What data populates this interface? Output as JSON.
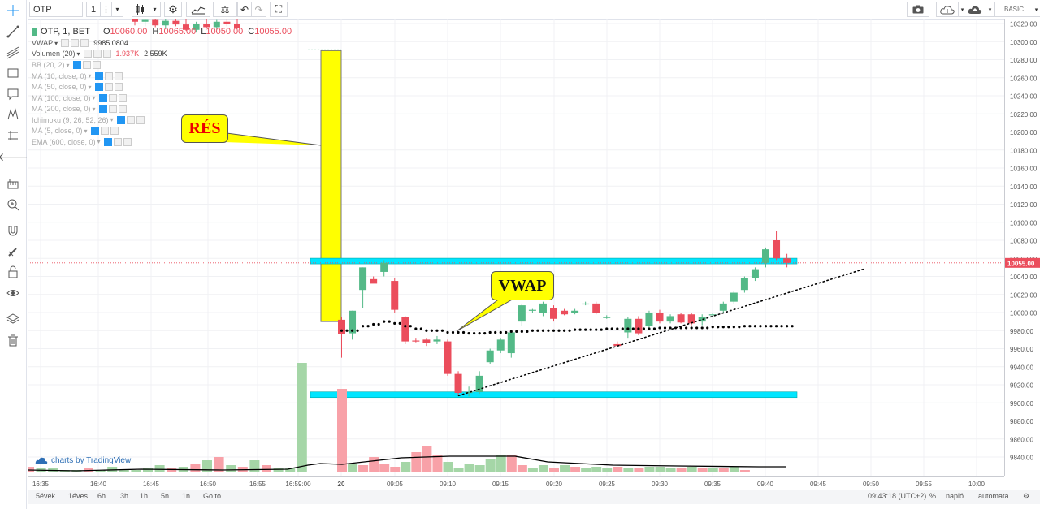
{
  "toolbar": {
    "symbol": "OTP",
    "interval": "1",
    "mode": "BASIC"
  },
  "legend": {
    "title": "OTP, 1, BET",
    "o_label": "O",
    "o_val": "10060.00",
    "h_label": "H",
    "h_val": "10065.00",
    "l_label": "L",
    "l_val": "10050.00",
    "c_label": "C",
    "c_val": "10055.00",
    "vwap_label": "VWAP",
    "vwap_val": "9985.0804",
    "vol_label": "Volumen (20)",
    "vol_val1": "1.937K",
    "vol_val2": "2.559K",
    "indicators": [
      "BB (20, 2)",
      "MA (10, close, 0)",
      "MA (50, close, 0)",
      "MA (100, close, 0)",
      "MA (200, close, 0)",
      "Ichimoku (9, 26, 52, 26)",
      "MA (5, close, 0)",
      "EMA (600, close, 0)"
    ]
  },
  "annotations": {
    "res": "RÉS",
    "vwap": "VWAP"
  },
  "watermark": "charts by TradingView",
  "bottombar": {
    "ranges": [
      "5évek",
      "1éves",
      "6h",
      "3h",
      "1h",
      "5n",
      "1n",
      "Go to..."
    ],
    "clock": "09:43:18 (UTC+2)",
    "pct": "%",
    "log": "napló",
    "auto": "automata"
  },
  "colors": {
    "up": "#53b987",
    "down": "#eb4d5c",
    "zone": "#00e5ff",
    "gap": "#ffff00",
    "accent": "#2196f3"
  },
  "chart_data": {
    "type": "candlestick",
    "title": "OTP, 1, BET",
    "last_price": "10055.00",
    "ylim": [
      9825,
      10325
    ],
    "y_ticks": [
      9840,
      9860,
      9880,
      9900,
      9920,
      9940,
      9960,
      9980,
      10000,
      10020,
      10040,
      10060,
      10080,
      10100,
      10120,
      10140,
      10160,
      10180,
      10200,
      10220,
      10240,
      10260,
      10280,
      10300,
      10320
    ],
    "x_ticks": [
      "16:35",
      "16:40",
      "16:45",
      "16:50",
      "16:55",
      "16:59:00",
      "20",
      "09:05",
      "09:10",
      "09:15",
      "09:20",
      "09:25",
      "09:30",
      "09:35",
      "09:40",
      "09:45",
      "09:50",
      "09:55",
      "10:00"
    ],
    "candles_prev_day": [
      {
        "o": 10325,
        "h": 10328,
        "l": 10318,
        "c": 10322
      },
      {
        "o": 10322,
        "h": 10326,
        "l": 10317,
        "c": 10324
      },
      {
        "o": 10324,
        "h": 10328,
        "l": 10316,
        "c": 10318
      },
      {
        "o": 10318,
        "h": 10326,
        "l": 10314,
        "c": 10323
      },
      {
        "o": 10323,
        "h": 10327,
        "l": 10317,
        "c": 10319
      },
      {
        "o": 10319,
        "h": 10325,
        "l": 10312,
        "c": 10313
      },
      {
        "o": 10313,
        "h": 10322,
        "l": 10310,
        "c": 10320
      },
      {
        "o": 10320,
        "h": 10326,
        "l": 10315,
        "c": 10316
      },
      {
        "o": 10316,
        "h": 10324,
        "l": 10313,
        "c": 10322
      },
      {
        "o": 10322,
        "h": 10326,
        "l": 10317,
        "c": 10320
      },
      {
        "o": 10320,
        "h": 10325,
        "l": 10314,
        "c": 10315
      }
    ],
    "candles": [
      {
        "o": 9992,
        "h": 9995,
        "l": 9950,
        "c": 9976
      },
      {
        "o": 9977,
        "h": 10002,
        "l": 9970,
        "c": 10002
      },
      {
        "o": 10025,
        "h": 10050,
        "l": 10005,
        "c": 10050
      },
      {
        "o": 10037,
        "h": 10040,
        "l": 10035,
        "c": 10032
      },
      {
        "o": 10045,
        "h": 10058,
        "l": 10040,
        "c": 10055
      },
      {
        "o": 10035,
        "h": 10038,
        "l": 10000,
        "c": 10003
      },
      {
        "o": 9995,
        "h": 9996,
        "l": 9965,
        "c": 9968
      },
      {
        "o": 9969,
        "h": 9972,
        "l": 9967,
        "c": 9968
      },
      {
        "o": 9970,
        "h": 9972,
        "l": 9963,
        "c": 9966
      },
      {
        "o": 9968,
        "h": 9974,
        "l": 9965,
        "c": 9970
      },
      {
        "o": 9968,
        "h": 9970,
        "l": 9930,
        "c": 9932
      },
      {
        "o": 9932,
        "h": 9935,
        "l": 9908,
        "c": 9911
      },
      {
        "o": 9911,
        "h": 9918,
        "l": 9907,
        "c": 9912
      },
      {
        "o": 9912,
        "h": 9935,
        "l": 9910,
        "c": 9930
      },
      {
        "o": 9945,
        "h": 9960,
        "l": 9943,
        "c": 9958
      },
      {
        "o": 9958,
        "h": 9972,
        "l": 9955,
        "c": 9970
      },
      {
        "o": 9955,
        "h": 9980,
        "l": 9950,
        "c": 9978
      },
      {
        "o": 9990,
        "h": 10010,
        "l": 9985,
        "c": 10008
      },
      {
        "o": 10002,
        "h": 10004,
        "l": 10000,
        "c": 10003
      },
      {
        "o": 10000,
        "h": 10012,
        "l": 9996,
        "c": 10010
      },
      {
        "o": 10005,
        "h": 10008,
        "l": 9990,
        "c": 9993
      },
      {
        "o": 10002,
        "h": 10004,
        "l": 9997,
        "c": 9998
      },
      {
        "o": 10000,
        "h": 10004,
        "l": 9998,
        "c": 10002
      },
      {
        "o": 10010,
        "h": 10012,
        "l": 10008,
        "c": 10010
      },
      {
        "o": 10010,
        "h": 10012,
        "l": 9998,
        "c": 10000
      },
      {
        "o": 9995,
        "h": 9997,
        "l": 9993,
        "c": 9995
      },
      {
        "o": 9965,
        "h": 9968,
        "l": 9962,
        "c": 9963
      },
      {
        "o": 9978,
        "h": 9995,
        "l": 9972,
        "c": 9993
      },
      {
        "o": 9993,
        "h": 9996,
        "l": 9975,
        "c": 9977
      },
      {
        "o": 9985,
        "h": 10002,
        "l": 9982,
        "c": 10000
      },
      {
        "o": 10000,
        "h": 10003,
        "l": 9988,
        "c": 9990
      },
      {
        "o": 9990,
        "h": 9998,
        "l": 9988,
        "c": 9996
      },
      {
        "o": 9998,
        "h": 10000,
        "l": 9988,
        "c": 9989
      },
      {
        "o": 9998,
        "h": 10000,
        "l": 9986,
        "c": 9988
      },
      {
        "o": 9990,
        "h": 9998,
        "l": 9986,
        "c": 9995
      },
      {
        "o": 9997,
        "h": 10000,
        "l": 9995,
        "c": 9998
      },
      {
        "o": 10002,
        "h": 10012,
        "l": 10000,
        "c": 10010
      },
      {
        "o": 10012,
        "h": 10024,
        "l": 10010,
        "c": 10022
      },
      {
        "o": 10025,
        "h": 10040,
        "l": 10022,
        "c": 10038
      },
      {
        "o": 10038,
        "h": 10050,
        "l": 10035,
        "c": 10048
      },
      {
        "o": 10055,
        "h": 10072,
        "l": 10050,
        "c": 10070
      },
      {
        "o": 10080,
        "h": 10090,
        "l": 10058,
        "c": 10060
      },
      {
        "o": 10060,
        "h": 10065,
        "l": 10050,
        "c": 10055
      }
    ],
    "volume": [
      {
        "v": 3,
        "up": false
      },
      {
        "v": 2,
        "up": true
      },
      {
        "v": 2,
        "up": true
      },
      {
        "v": 1,
        "up": true
      },
      {
        "v": 1,
        "up": true
      },
      {
        "v": 2,
        "up": false
      },
      {
        "v": 1,
        "up": true
      },
      {
        "v": 3,
        "up": true
      },
      {
        "v": 1,
        "up": true
      },
      {
        "v": 1,
        "up": true
      },
      {
        "v": 2,
        "up": true
      },
      {
        "v": 4,
        "up": true
      },
      {
        "v": 2,
        "up": false
      },
      {
        "v": 3,
        "up": true
      },
      {
        "v": 5,
        "up": false
      },
      {
        "v": 7,
        "up": true
      },
      {
        "v": 9,
        "up": false
      },
      {
        "v": 4,
        "up": true
      },
      {
        "v": 3,
        "up": false
      },
      {
        "v": 7,
        "up": true
      },
      {
        "v": 4,
        "up": false
      },
      {
        "v": 2,
        "up": true
      },
      {
        "v": 2,
        "up": true
      },
      {
        "v": 67,
        "up": true
      },
      {
        "v": 51,
        "up": false
      },
      {
        "v": 5,
        "up": true
      },
      {
        "v": 4,
        "up": false
      },
      {
        "v": 9,
        "up": false
      },
      {
        "v": 5,
        "up": false
      },
      {
        "v": 3,
        "up": false
      },
      {
        "v": 6,
        "up": true
      },
      {
        "v": 12,
        "up": false
      },
      {
        "v": 16,
        "up": false
      },
      {
        "v": 10,
        "up": false
      },
      {
        "v": 6,
        "up": true
      },
      {
        "v": 2,
        "up": true
      },
      {
        "v": 5,
        "up": true
      },
      {
        "v": 4,
        "up": true
      },
      {
        "v": 8,
        "up": true
      },
      {
        "v": 10,
        "up": true
      },
      {
        "v": 10,
        "up": false
      },
      {
        "v": 4,
        "up": false
      },
      {
        "v": 2,
        "up": true
      },
      {
        "v": 4,
        "up": true
      },
      {
        "v": 2,
        "up": false
      },
      {
        "v": 4,
        "up": true
      },
      {
        "v": 3,
        "up": false
      },
      {
        "v": 2,
        "up": true
      },
      {
        "v": 3,
        "up": true
      },
      {
        "v": 2,
        "up": true
      },
      {
        "v": 3,
        "up": false
      },
      {
        "v": 2,
        "up": true
      },
      {
        "v": 2,
        "up": false
      },
      {
        "v": 3,
        "up": true
      },
      {
        "v": 3,
        "up": true
      },
      {
        "v": 2,
        "up": true
      },
      {
        "v": 2,
        "up": false
      },
      {
        "v": 3,
        "up": true
      },
      {
        "v": 2,
        "up": false
      },
      {
        "v": 2,
        "up": true
      },
      {
        "v": 2,
        "up": false
      },
      {
        "v": 3,
        "up": true
      },
      {
        "v": 1,
        "up": false
      }
    ],
    "vwap_dotted": [
      9980,
      9980,
      9985,
      9987,
      9990,
      9988,
      9985,
      9982,
      9980,
      9980,
      9978,
      9978,
      9977,
      9977,
      9978,
      9978,
      9979,
      9979,
      9980,
      9980,
      9980,
      9980,
      9981,
      9981,
      9981,
      9982,
      9982,
      9982,
      9982,
      9982,
      9983,
      9983,
      9983,
      9983,
      9983,
      9984,
      9984,
      9984,
      9985,
      9985,
      9985,
      9985,
      9985
    ],
    "trendline": {
      "from": [
        "09:12",
        9908
      ],
      "to": [
        "09:48",
        10035
      ]
    },
    "zones": [
      {
        "name": "resistance",
        "value": 10057
      },
      {
        "name": "support",
        "value": 9909
      }
    ],
    "gap": {
      "from_value": 10290,
      "to_value": 9990
    }
  }
}
